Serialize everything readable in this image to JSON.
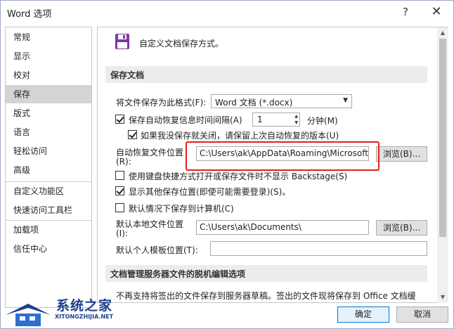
{
  "window": {
    "title": "Word 选项",
    "help": "?",
    "close": "✕"
  },
  "nav": {
    "items": [
      {
        "label": "常规"
      },
      {
        "label": "显示"
      },
      {
        "label": "校对"
      },
      {
        "label": "保存"
      },
      {
        "label": "版式"
      },
      {
        "label": "语言"
      },
      {
        "label": "轻松访问"
      },
      {
        "label": "高级"
      },
      {
        "label": "自定义功能区"
      },
      {
        "label": "快速访问工具栏"
      },
      {
        "label": "加载项"
      },
      {
        "label": "信任中心"
      }
    ],
    "active": "保存"
  },
  "header": {
    "text": "自定义文档保存方式。",
    "icon": "save-disk-icon"
  },
  "section_save": {
    "title": "保存文档",
    "format_label": "将文件保存为此格式(F):",
    "format_value": "Word 文档 (*.docx)",
    "autorecover_label": "保存自动恢复信息时间间隔(A)",
    "autorecover_value": "1",
    "minutes_label": "分钟(M)",
    "keep_last_label": "如果我没保存就关闭，请保留上次自动恢复的版本(U)",
    "autorecover_loc_label1": "自动恢复文件位置",
    "autorecover_loc_label2": "(R):",
    "autorecover_loc_value": "C:\\Users\\ak\\AppData\\Roaming\\Microsoft\\Word\\",
    "browse1": "浏览(B)...",
    "no_backstage_label": "使用键盘快捷方式打开或保存文件时不显示 Backstage(S)",
    "show_other_label": "显示其他保存位置(即使可能需要登录)(S)。",
    "save_to_computer_label": "默认情况下保存到计算机(C)",
    "default_local_label1": "默认本地文件位置",
    "default_local_label2": "(I):",
    "default_local_value": "C:\\Users\\ak\\Documents\\",
    "browse2": "浏览(B)...",
    "template_label": "默认个人模板位置(T):",
    "template_value": ""
  },
  "section_offline": {
    "title": "文档管理服务器文件的脱机编辑选项",
    "note": "不再支持将签出的文件保存到服务器草稿。签出的文件现将保存到 Office 文档缓"
  },
  "checks": {
    "autorecover": true,
    "keep_last": true,
    "no_backstage": false,
    "show_other": true,
    "save_to_computer": false
  },
  "footer": {
    "ok": "确定",
    "cancel": "取消"
  },
  "watermark": {
    "title": "系统之家",
    "sub": "XITONGZHIJIA.NET"
  },
  "colors": {
    "accent": "#0078d7",
    "highlight": "#e02020",
    "watermark": "#1d3f8f"
  }
}
